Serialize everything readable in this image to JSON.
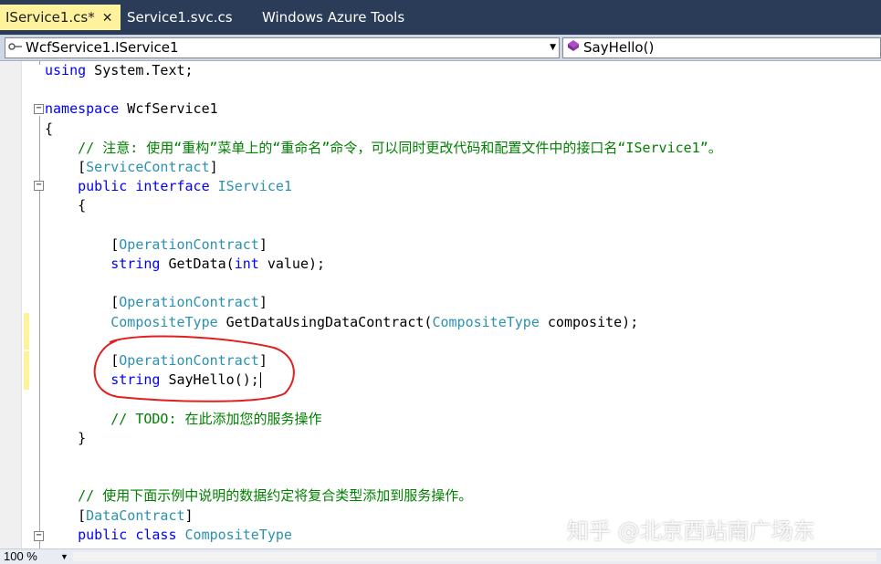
{
  "tabs": [
    {
      "label": "IService1.cs*",
      "active": true
    },
    {
      "label": "Service1.svc.cs",
      "active": false
    },
    {
      "label": "Windows Azure Tools",
      "active": false
    }
  ],
  "tab_close_glyph": "✕",
  "navbar": {
    "type_combo": "WcfService1.IService1",
    "member_combo": "SayHello()"
  },
  "code_lines": [
    {
      "segments": [
        {
          "t": "using",
          "c": "kw"
        },
        {
          "t": " System.Text;",
          "c": ""
        }
      ]
    },
    {
      "segments": []
    },
    {
      "segments": [
        {
          "t": "namespace",
          "c": "kw"
        },
        {
          "t": " WcfService1",
          "c": ""
        }
      ]
    },
    {
      "segments": [
        {
          "t": "{",
          "c": ""
        }
      ]
    },
    {
      "segments": [
        {
          "t": "    // 注意: 使用“重构”菜单上的“重命名”命令，可以同时更改代码和配置文件中的接口名“IService1”。",
          "c": "cm"
        }
      ]
    },
    {
      "segments": [
        {
          "t": "    [",
          "c": ""
        },
        {
          "t": "ServiceContract",
          "c": "ty"
        },
        {
          "t": "]",
          "c": ""
        }
      ]
    },
    {
      "segments": [
        {
          "t": "    ",
          "c": ""
        },
        {
          "t": "public",
          "c": "kw"
        },
        {
          "t": " ",
          "c": ""
        },
        {
          "t": "interface",
          "c": "kw"
        },
        {
          "t": " ",
          "c": ""
        },
        {
          "t": "IService1",
          "c": "ty"
        }
      ]
    },
    {
      "segments": [
        {
          "t": "    {",
          "c": ""
        }
      ]
    },
    {
      "segments": []
    },
    {
      "segments": [
        {
          "t": "        [",
          "c": ""
        },
        {
          "t": "OperationContract",
          "c": "ty"
        },
        {
          "t": "]",
          "c": ""
        }
      ]
    },
    {
      "segments": [
        {
          "t": "        ",
          "c": ""
        },
        {
          "t": "string",
          "c": "kw"
        },
        {
          "t": " GetData(",
          "c": ""
        },
        {
          "t": "int",
          "c": "kw"
        },
        {
          "t": " value);",
          "c": ""
        }
      ]
    },
    {
      "segments": []
    },
    {
      "segments": [
        {
          "t": "        [",
          "c": ""
        },
        {
          "t": "OperationContract",
          "c": "ty"
        },
        {
          "t": "]",
          "c": ""
        }
      ]
    },
    {
      "segments": [
        {
          "t": "        ",
          "c": ""
        },
        {
          "t": "CompositeType",
          "c": "ty"
        },
        {
          "t": " GetDataUsingDataContract(",
          "c": ""
        },
        {
          "t": "CompositeType",
          "c": "ty"
        },
        {
          "t": " composite);",
          "c": ""
        }
      ]
    },
    {
      "segments": []
    },
    {
      "segments": [
        {
          "t": "        [",
          "c": ""
        },
        {
          "t": "OperationContract",
          "c": "ty"
        },
        {
          "t": "]",
          "c": ""
        }
      ]
    },
    {
      "segments": [
        {
          "t": "        ",
          "c": ""
        },
        {
          "t": "string",
          "c": "kw"
        },
        {
          "t": " SayHello();",
          "c": ""
        }
      ],
      "caret": true
    },
    {
      "segments": []
    },
    {
      "segments": [
        {
          "t": "        // TODO: 在此添加您的服务操作",
          "c": "cm"
        }
      ]
    },
    {
      "segments": [
        {
          "t": "    }",
          "c": ""
        }
      ]
    },
    {
      "segments": []
    },
    {
      "segments": []
    },
    {
      "segments": [
        {
          "t": "    // 使用下面示例中说明的数据约定将复合类型添加到服务操作。",
          "c": "cm"
        }
      ]
    },
    {
      "segments": [
        {
          "t": "    [",
          "c": ""
        },
        {
          "t": "DataContract",
          "c": "ty"
        },
        {
          "t": "]",
          "c": ""
        }
      ]
    },
    {
      "segments": [
        {
          "t": "    ",
          "c": ""
        },
        {
          "t": "public",
          "c": "kw"
        },
        {
          "t": " ",
          "c": ""
        },
        {
          "t": "class",
          "c": "kw"
        },
        {
          "t": " ",
          "c": ""
        },
        {
          "t": "CompositeType",
          "c": "ty"
        }
      ]
    }
  ],
  "status": {
    "zoom": "100 %"
  },
  "watermark": "知乎 @北京西站南广场东",
  "colors": {
    "tab_strip": "#2b3c59",
    "active_tab": "#fff29d",
    "keyword": "#0000ff",
    "type": "#2b91af",
    "comment": "#008000",
    "annotation_circle": "#e02020",
    "change_bar": "#fff29d"
  },
  "icons": {
    "type_combo_icon": "class-icon",
    "member_combo_icon": "method-icon"
  }
}
